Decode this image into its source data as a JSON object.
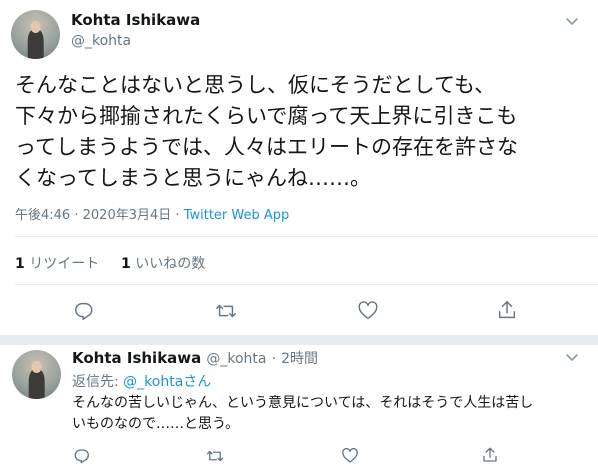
{
  "main_tweet": {
    "author_name": "Kohta Ishikawa",
    "author_handle": "@_kohta",
    "text": "そんなことはないと思うし、仮にそうだとしても、\n下々から揶揄されたくらいで腐って天上界に引きこも\nってしまうようでは、人々はエリートの存在を許さな\nくなってしまうと思うにゃんね……。",
    "time": "午後4:46",
    "separator": "·",
    "date": "2020年3月4日",
    "source": "Twitter Web App",
    "retweet_count": "1",
    "retweet_label": "リツイート",
    "like_count": "1",
    "like_label": "いいねの数"
  },
  "reply_tweet": {
    "author_name": "Kohta Ishikawa",
    "author_handle": "@_kohta",
    "separator": "·",
    "time_ago": "2時間",
    "reply_to_label": "返信先:",
    "reply_to_handle": "@_kohta",
    "reply_to_suffix": "さん",
    "text": "そんなの苦しいじゃん、という意見については、それはそうで人生は苦し\nいものなので……と思う。"
  },
  "colors": {
    "link": "#1b95e0",
    "secondary_text": "#657786",
    "divider": "#e6ecf0"
  },
  "icons": [
    "chevron-down-icon",
    "reply-icon",
    "retweet-icon",
    "like-icon",
    "share-icon"
  ]
}
